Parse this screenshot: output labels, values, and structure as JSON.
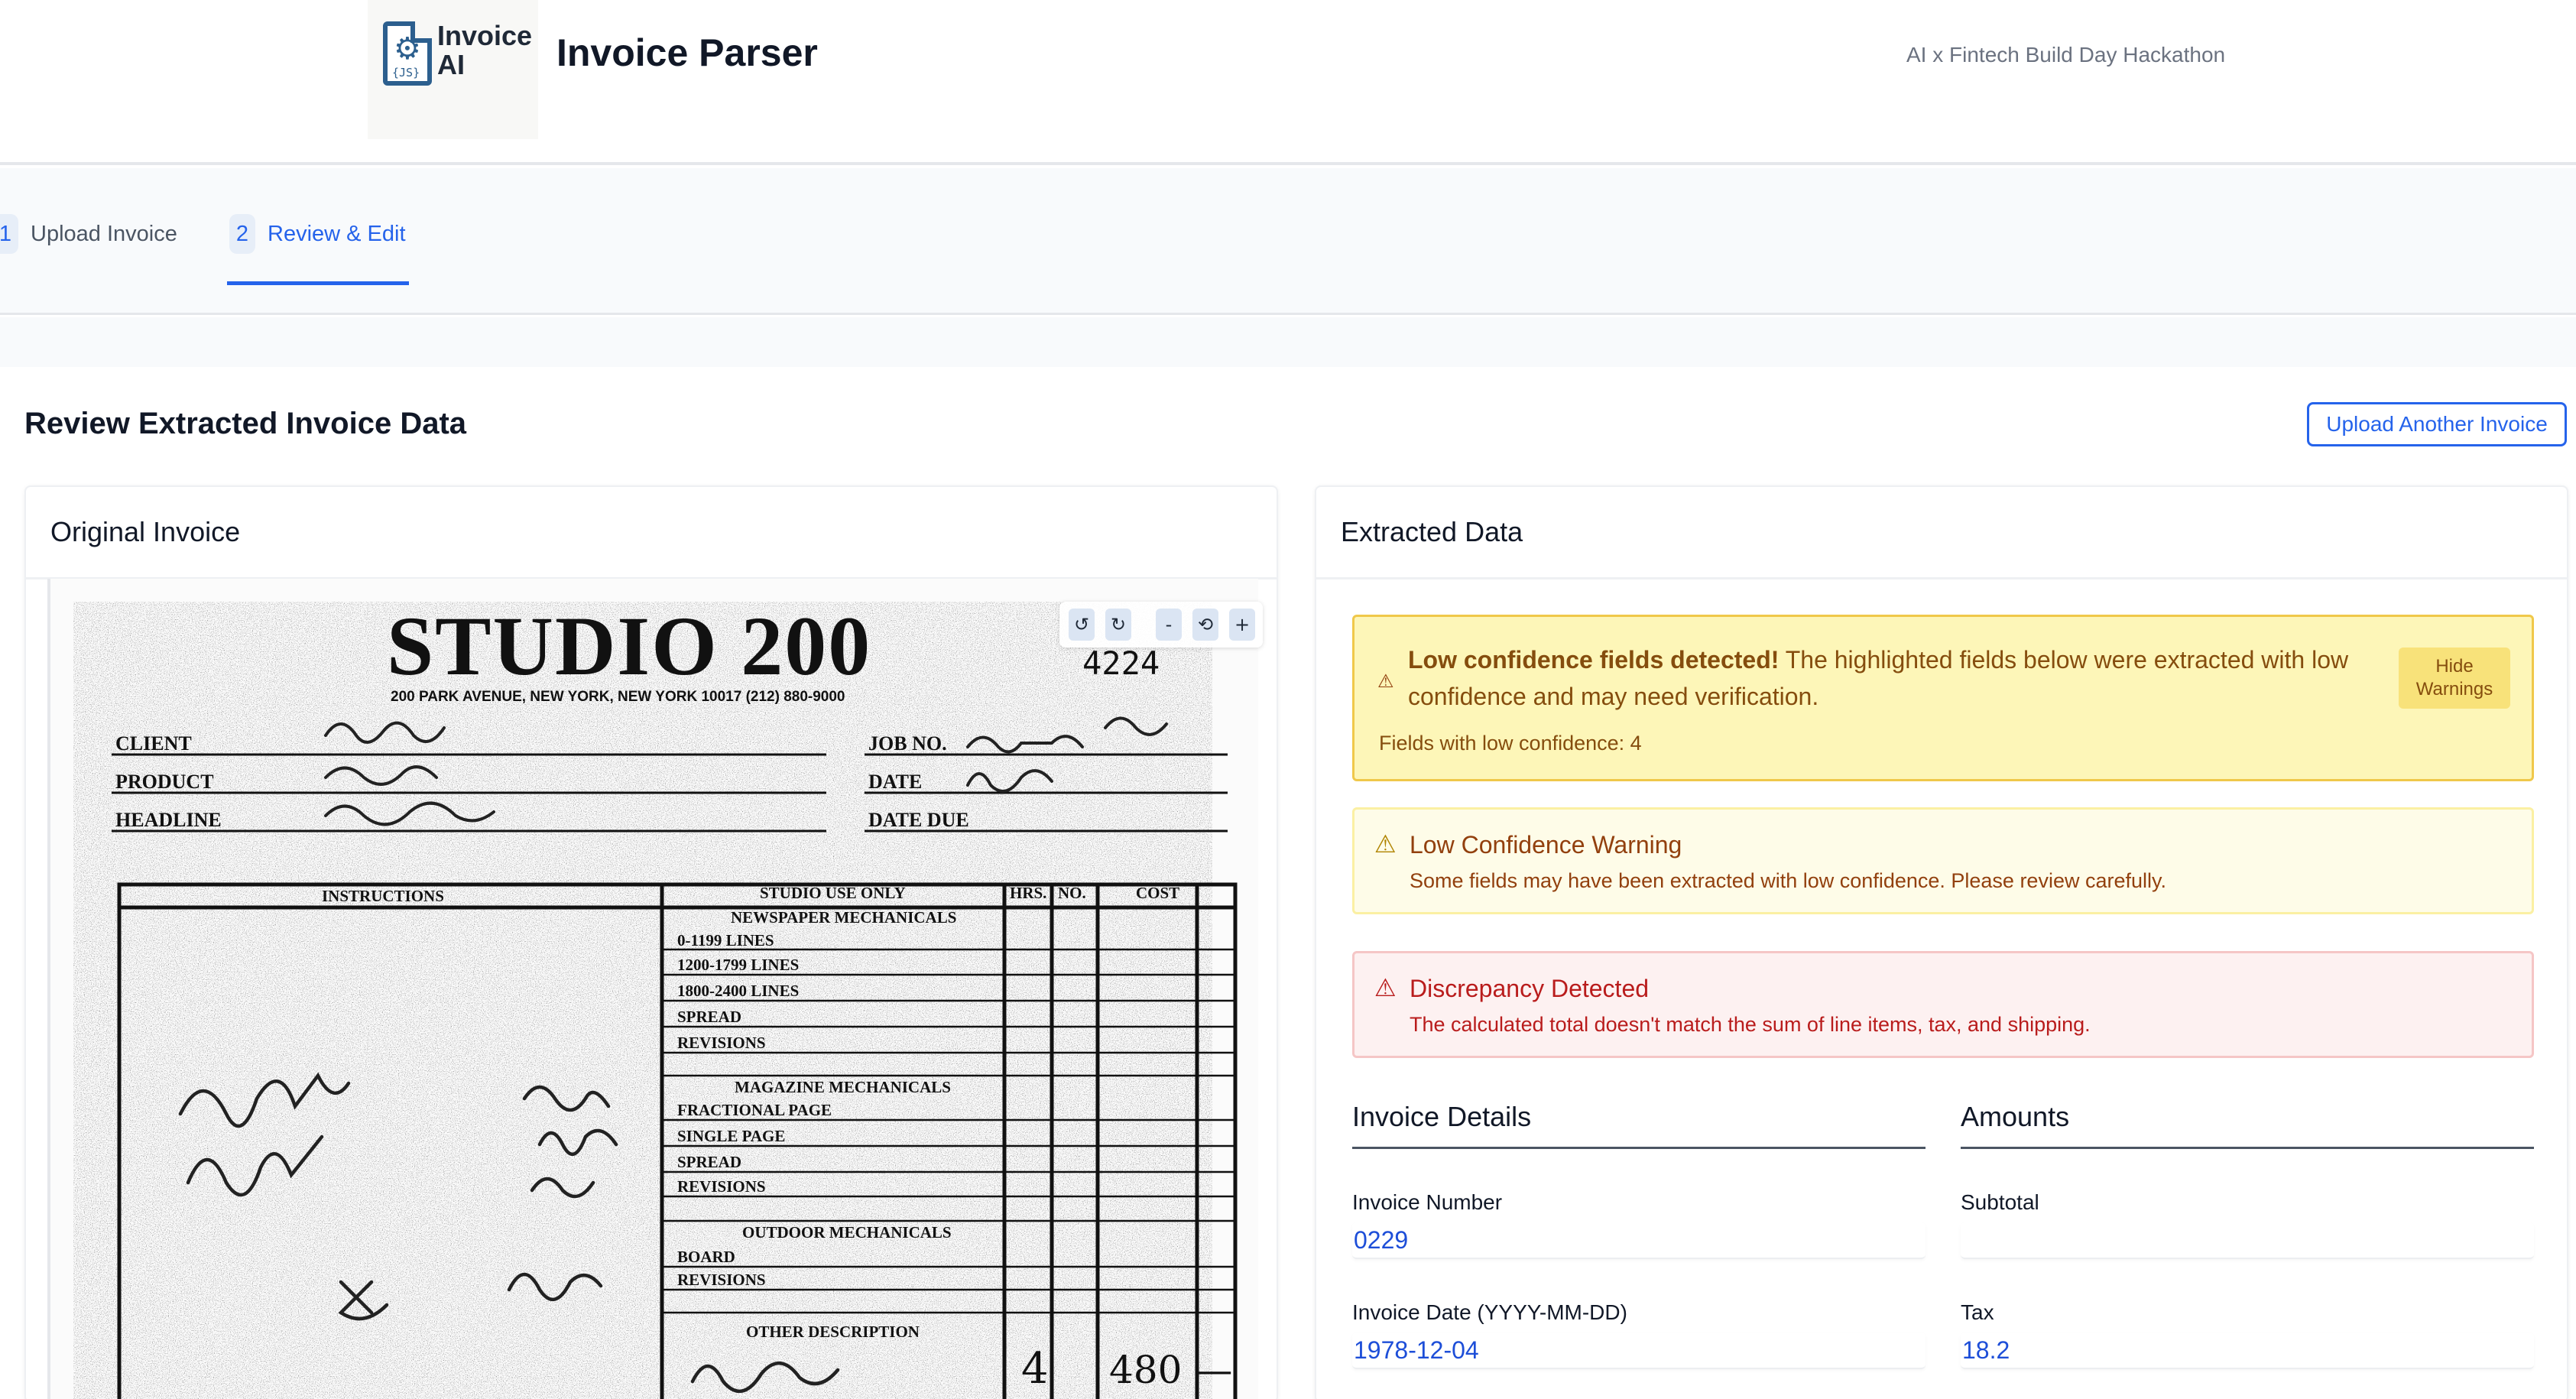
{
  "header": {
    "logo_text": "Invoice AI",
    "logo_badge": "{JS}",
    "title": "Invoice Parser",
    "event": "AI x Fintech Build Day Hackathon"
  },
  "steps": [
    {
      "num": "1",
      "label": "Upload Invoice",
      "active": false
    },
    {
      "num": "2",
      "label": "Review & Edit",
      "active": true
    }
  ],
  "page": {
    "heading": "Review Extracted Invoice Data",
    "upload_another": "Upload Another Invoice"
  },
  "left_panel": {
    "title": "Original Invoice",
    "toolbar": {
      "rotate_left": "↺",
      "rotate_right": "↻",
      "zoom_out": "-",
      "reset": "⟲",
      "zoom_in": "+"
    },
    "invoice_image": {
      "brand": "STUDIO 200",
      "address": "200 PARK AVENUE,  NEW YORK, NEW YORK 10017   (212) 880-9000",
      "number": "4224",
      "client_label": "CLIENT",
      "product_label": "PRODUCT",
      "headline_label": "HEADLINE",
      "job_label": "JOB NO.",
      "date_label": "DATE",
      "date_due_label": "DATE DUE",
      "instructions": "INSTRUCTIONS",
      "studio_use": "STUDIO USE ONLY",
      "hrs": "HRS.",
      "no": "NO.",
      "cost": "COST",
      "newspaper": "NEWSPAPER MECHANICALS",
      "lines_1": "0-1199 LINES",
      "lines_2": "1200-1799 LINES",
      "lines_3": "1800-2400 LINES",
      "spread": "SPREAD",
      "revisions": "REVISIONS",
      "magazine": "MAGAZINE MECHANICALS",
      "fractional": "FRACTIONAL PAGE",
      "single": "SINGLE PAGE",
      "outdoor": "OUTDOOR MECHANICALS",
      "board": "BOARD",
      "other": "OTHER DESCRIPTION",
      "hw_qty": "4",
      "hw_cost": "480 —"
    }
  },
  "right_panel": {
    "title": "Extracted Data",
    "low_conf_alert": {
      "bold": "Low confidence fields detected!",
      "text": " The highlighted fields below were extracted with low confidence and may need verification.",
      "count_text": "Fields with low confidence: 4",
      "hide_button": "Hide Warnings"
    },
    "warning": {
      "title": "Low Confidence Warning",
      "body": "Some fields may have been extracted with low confidence. Please review carefully."
    },
    "discrepancy": {
      "title": "Discrepancy Detected",
      "body": "The calculated total doesn't match the sum of line items, tax, and shipping."
    },
    "invoice_details": {
      "title": "Invoice Details",
      "invoice_number_label": "Invoice Number",
      "invoice_number": "0229",
      "invoice_date_label": "Invoice Date (YYYY-MM-DD)",
      "invoice_date": "1978-12-04"
    },
    "amounts": {
      "title": "Amounts",
      "subtotal_label": "Subtotal",
      "subtotal": "",
      "tax_label": "Tax",
      "tax": "18.2"
    }
  },
  "colors": {
    "accent": "#2563eb",
    "warning_bg": "#fdf6b8",
    "warning_border": "#f0c84a",
    "error_bg": "#fdf1f1",
    "error_text": "#b91c1c"
  }
}
